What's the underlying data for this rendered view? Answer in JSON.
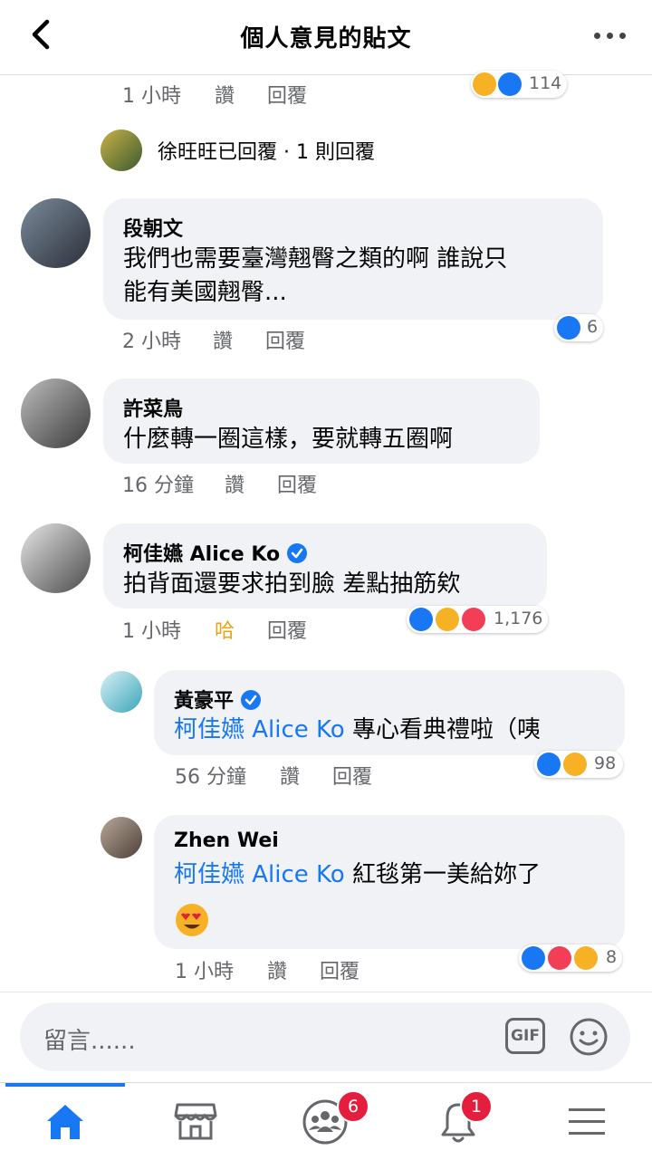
{
  "header": {
    "title": "個人意見的貼文"
  },
  "top_meta": {
    "time": "1 小時",
    "like": "讚",
    "reply": "回覆",
    "reaction_count": "114"
  },
  "reply_summary": {
    "text": "徐旺旺已回覆 · 1 則回覆"
  },
  "comments": [
    {
      "author": "段朝文",
      "text_lines": [
        "我們也需要臺灣翹臀之類的啊 誰說只",
        "能有美國翹臀..."
      ],
      "time": "2 小時",
      "like": "讚",
      "reply": "回覆",
      "reaction_count": "6"
    },
    {
      "author": "許菜鳥",
      "text_lines": [
        "什麼轉一圈這樣，要就轉五圈啊"
      ],
      "time": "16 分鐘",
      "like": "讚",
      "reply": "回覆"
    },
    {
      "author": "柯佳嬿 Alice Ko",
      "text_lines": [
        "拍背面還要求拍到臉 差點抽筋欸"
      ],
      "time": "1 小時",
      "like": "哈",
      "reply": "回覆",
      "reaction_count": "1,176"
    }
  ],
  "replies": [
    {
      "author": "黃豪平",
      "mention": "柯佳嬿 Alice Ko",
      "text": " 專心看典禮啦（咦",
      "time": "56 分鐘",
      "like": "讚",
      "reply": "回覆",
      "reaction_count": "98"
    },
    {
      "author": "Zhen Wei",
      "mention": "柯佳嬿 Alice Ko",
      "text": " 紅毯第一美給妳了",
      "time": "1 小時",
      "like": "讚",
      "reply": "回覆",
      "reaction_count": "8"
    }
  ],
  "composer": {
    "placeholder": "留言......",
    "gif_label": "GIF"
  },
  "nav": {
    "groups_badge": "6",
    "notifications_badge": "1"
  },
  "colors": {
    "brand_blue": "#1877f2",
    "like_active": "#f7b125",
    "badge_red": "#e41e3f",
    "bubble_bg": "#f0f2f5"
  },
  "icons": [
    "back-arrow-icon",
    "more-options-icon",
    "like-reaction-icon",
    "haha-reaction-icon",
    "love-reaction-icon",
    "gif-icon",
    "emoji-icon",
    "home-icon",
    "marketplace-icon",
    "groups-icon",
    "bell-icon",
    "menu-icon"
  ]
}
